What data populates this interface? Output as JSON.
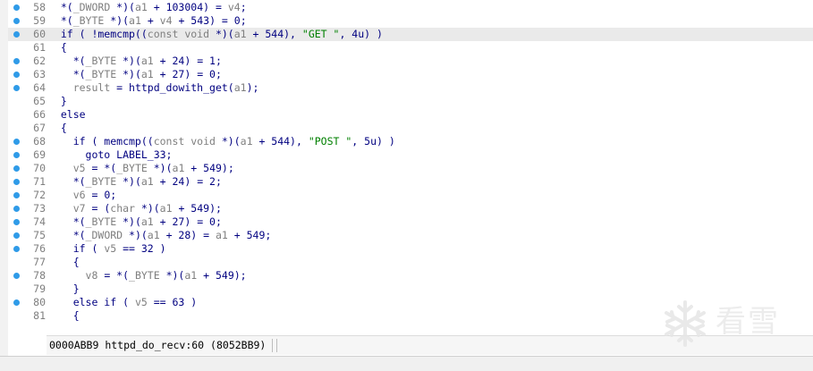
{
  "code": {
    "lines": [
      {
        "no": "58",
        "bp": true,
        "current": false,
        "tokens": [
          {
            "t": "  *(",
            "c": "plain"
          },
          {
            "t": "_DWORD",
            "c": "var"
          },
          {
            "t": " *)(",
            "c": "plain"
          },
          {
            "t": "a1",
            "c": "var"
          },
          {
            "t": " + 103004) = ",
            "c": "plain"
          },
          {
            "t": "v4",
            "c": "var"
          },
          {
            "t": ";",
            "c": "plain"
          }
        ]
      },
      {
        "no": "59",
        "bp": true,
        "current": false,
        "tokens": [
          {
            "t": "  *(",
            "c": "plain"
          },
          {
            "t": "_BYTE",
            "c": "var"
          },
          {
            "t": " *)(",
            "c": "plain"
          },
          {
            "t": "a1",
            "c": "var"
          },
          {
            "t": " + ",
            "c": "plain"
          },
          {
            "t": "v4",
            "c": "var"
          },
          {
            "t": " + 543) = 0;",
            "c": "plain"
          }
        ]
      },
      {
        "no": "60",
        "bp": true,
        "current": true,
        "tokens": [
          {
            "t": "  if ( !memcmp((",
            "c": "plain"
          },
          {
            "t": "const void",
            "c": "var"
          },
          {
            "t": " *)(",
            "c": "plain"
          },
          {
            "t": "a1",
            "c": "var"
          },
          {
            "t": " + 544), ",
            "c": "plain"
          },
          {
            "t": "\"GET \"",
            "c": "str"
          },
          {
            "t": ", 4u) )",
            "c": "plain"
          }
        ]
      },
      {
        "no": "61",
        "bp": false,
        "current": false,
        "tokens": [
          {
            "t": "  {",
            "c": "plain"
          }
        ]
      },
      {
        "no": "62",
        "bp": true,
        "current": false,
        "tokens": [
          {
            "t": "    *(",
            "c": "plain"
          },
          {
            "t": "_BYTE",
            "c": "var"
          },
          {
            "t": " *)(",
            "c": "plain"
          },
          {
            "t": "a1",
            "c": "var"
          },
          {
            "t": " + 24) = 1;",
            "c": "plain"
          }
        ]
      },
      {
        "no": "63",
        "bp": true,
        "current": false,
        "tokens": [
          {
            "t": "    *(",
            "c": "plain"
          },
          {
            "t": "_BYTE",
            "c": "var"
          },
          {
            "t": " *)(",
            "c": "plain"
          },
          {
            "t": "a1",
            "c": "var"
          },
          {
            "t": " + 27) = 0;",
            "c": "plain"
          }
        ]
      },
      {
        "no": "64",
        "bp": true,
        "current": false,
        "tokens": [
          {
            "t": "    ",
            "c": "plain"
          },
          {
            "t": "result",
            "c": "var"
          },
          {
            "t": " = httpd_dowith_get(",
            "c": "plain"
          },
          {
            "t": "a1",
            "c": "var"
          },
          {
            "t": ");",
            "c": "plain"
          }
        ]
      },
      {
        "no": "65",
        "bp": false,
        "current": false,
        "tokens": [
          {
            "t": "  }",
            "c": "plain"
          }
        ]
      },
      {
        "no": "66",
        "bp": false,
        "current": false,
        "tokens": [
          {
            "t": "  else",
            "c": "plain"
          }
        ]
      },
      {
        "no": "67",
        "bp": false,
        "current": false,
        "tokens": [
          {
            "t": "  {",
            "c": "plain"
          }
        ]
      },
      {
        "no": "68",
        "bp": true,
        "current": false,
        "tokens": [
          {
            "t": "    if ( memcmp((",
            "c": "plain"
          },
          {
            "t": "const void",
            "c": "var"
          },
          {
            "t": " *)(",
            "c": "plain"
          },
          {
            "t": "a1",
            "c": "var"
          },
          {
            "t": " + 544), ",
            "c": "plain"
          },
          {
            "t": "\"POST \"",
            "c": "str"
          },
          {
            "t": ", 5u) )",
            "c": "plain"
          }
        ]
      },
      {
        "no": "69",
        "bp": true,
        "current": false,
        "tokens": [
          {
            "t": "      goto LABEL_33;",
            "c": "plain"
          }
        ]
      },
      {
        "no": "70",
        "bp": true,
        "current": false,
        "tokens": [
          {
            "t": "    ",
            "c": "plain"
          },
          {
            "t": "v5",
            "c": "var"
          },
          {
            "t": " = *(",
            "c": "plain"
          },
          {
            "t": "_BYTE",
            "c": "var"
          },
          {
            "t": " *)(",
            "c": "plain"
          },
          {
            "t": "a1",
            "c": "var"
          },
          {
            "t": " + 549);",
            "c": "plain"
          }
        ]
      },
      {
        "no": "71",
        "bp": true,
        "current": false,
        "tokens": [
          {
            "t": "    *(",
            "c": "plain"
          },
          {
            "t": "_BYTE",
            "c": "var"
          },
          {
            "t": " *)(",
            "c": "plain"
          },
          {
            "t": "a1",
            "c": "var"
          },
          {
            "t": " + 24) = 2;",
            "c": "plain"
          }
        ]
      },
      {
        "no": "72",
        "bp": true,
        "current": false,
        "tokens": [
          {
            "t": "    ",
            "c": "plain"
          },
          {
            "t": "v6",
            "c": "var"
          },
          {
            "t": " = 0;",
            "c": "plain"
          }
        ]
      },
      {
        "no": "73",
        "bp": true,
        "current": false,
        "tokens": [
          {
            "t": "    ",
            "c": "plain"
          },
          {
            "t": "v7",
            "c": "var"
          },
          {
            "t": " = (",
            "c": "plain"
          },
          {
            "t": "char",
            "c": "var"
          },
          {
            "t": " *)(",
            "c": "plain"
          },
          {
            "t": "a1",
            "c": "var"
          },
          {
            "t": " + 549);",
            "c": "plain"
          }
        ]
      },
      {
        "no": "74",
        "bp": true,
        "current": false,
        "tokens": [
          {
            "t": "    *(",
            "c": "plain"
          },
          {
            "t": "_BYTE",
            "c": "var"
          },
          {
            "t": " *)(",
            "c": "plain"
          },
          {
            "t": "a1",
            "c": "var"
          },
          {
            "t": " + 27) = 0;",
            "c": "plain"
          }
        ]
      },
      {
        "no": "75",
        "bp": true,
        "current": false,
        "tokens": [
          {
            "t": "    *(",
            "c": "plain"
          },
          {
            "t": "_DWORD",
            "c": "var"
          },
          {
            "t": " *)(",
            "c": "plain"
          },
          {
            "t": "a1",
            "c": "var"
          },
          {
            "t": " + 28) = ",
            "c": "plain"
          },
          {
            "t": "a1",
            "c": "var"
          },
          {
            "t": " + 549;",
            "c": "plain"
          }
        ]
      },
      {
        "no": "76",
        "bp": true,
        "current": false,
        "tokens": [
          {
            "t": "    if ( ",
            "c": "plain"
          },
          {
            "t": "v5",
            "c": "var"
          },
          {
            "t": " == 32 )",
            "c": "plain"
          }
        ]
      },
      {
        "no": "77",
        "bp": false,
        "current": false,
        "tokens": [
          {
            "t": "    {",
            "c": "plain"
          }
        ]
      },
      {
        "no": "78",
        "bp": true,
        "current": false,
        "tokens": [
          {
            "t": "      ",
            "c": "plain"
          },
          {
            "t": "v8",
            "c": "var"
          },
          {
            "t": " = *(",
            "c": "plain"
          },
          {
            "t": "_BYTE",
            "c": "var"
          },
          {
            "t": " *)(",
            "c": "plain"
          },
          {
            "t": "a1",
            "c": "var"
          },
          {
            "t": " + 549);",
            "c": "plain"
          }
        ]
      },
      {
        "no": "79",
        "bp": false,
        "current": false,
        "tokens": [
          {
            "t": "    }",
            "c": "plain"
          }
        ]
      },
      {
        "no": "80",
        "bp": true,
        "current": false,
        "tokens": [
          {
            "t": "    else if ( ",
            "c": "plain"
          },
          {
            "t": "v5",
            "c": "var"
          },
          {
            "t": " == 63 )",
            "c": "plain"
          }
        ]
      },
      {
        "no": "81",
        "bp": false,
        "current": false,
        "tokens": [
          {
            "t": "    {",
            "c": "plain"
          }
        ]
      }
    ]
  },
  "status_bar": {
    "address": "0000ABB9",
    "location": "httpd_do_recv:60",
    "ea": "(8052BB9)"
  },
  "watermark": {
    "text": "看雪",
    "icon": "snowflake-logo-icon"
  },
  "colors": {
    "breakpoint": "#2f9be8",
    "code_text": "#000080",
    "variable": "#7f7f7f",
    "string": "#008000",
    "current_line": "#eaeaea"
  }
}
